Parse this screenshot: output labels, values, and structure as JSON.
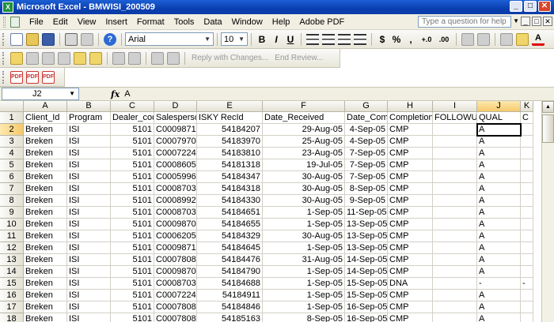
{
  "window": {
    "title": "Microsoft Excel - BMWISI_200509",
    "app_icon": "X",
    "buttons": [
      "_",
      "□",
      "✕"
    ]
  },
  "menubar": {
    "items": [
      "File",
      "Edit",
      "View",
      "Insert",
      "Format",
      "Tools",
      "Data",
      "Window",
      "Help",
      "Adobe PDF"
    ],
    "help_placeholder": "Type a question for help",
    "doc_buttons": [
      "_",
      "□",
      "✕"
    ]
  },
  "toolbar": {
    "font_name": "Arial",
    "font_size": "10",
    "bold": "B",
    "italic": "I",
    "underline": "U",
    "currency": "$",
    "percent": "%",
    "comma": ",",
    "inc_decimal": "+.0",
    "dec_decimal": ".00",
    "reply_changes": "Reply with Changes...",
    "end_review": "End Review..."
  },
  "formula_bar": {
    "name_box": "J2",
    "fx": "fx",
    "value": "A"
  },
  "grid": {
    "columns": [
      "A",
      "B",
      "C",
      "D",
      "E",
      "F",
      "G",
      "H",
      "I",
      "J",
      "K"
    ],
    "selected_column": "J",
    "selected_row": "2",
    "rows": [
      {
        "n": "1",
        "cells": [
          "Client_Id",
          "Program",
          "Dealer_code",
          "Salesperson",
          "ISKY RecId",
          "Date_Received",
          "Date_Completed",
          "Completion",
          "FOLLOWUP",
          "QUAL",
          "C"
        ]
      },
      {
        "n": "2",
        "cells": [
          "Breken",
          "ISI",
          "5101",
          "C0009871",
          "54184207",
          "29-Aug-05",
          "4-Sep-05",
          "CMP",
          "",
          "A",
          ""
        ]
      },
      {
        "n": "3",
        "cells": [
          "Breken",
          "ISI",
          "5101",
          "C0007970",
          "54183970",
          "25-Aug-05",
          "4-Sep-05",
          "CMP",
          "",
          "A",
          ""
        ]
      },
      {
        "n": "4",
        "cells": [
          "Breken",
          "ISI",
          "5101",
          "C0007224",
          "54183810",
          "23-Aug-05",
          "7-Sep-05",
          "CMP",
          "",
          "A",
          ""
        ]
      },
      {
        "n": "5",
        "cells": [
          "Breken",
          "ISI",
          "5101",
          "C0008605",
          "54181318",
          "19-Jul-05",
          "7-Sep-05",
          "CMP",
          "",
          "A",
          ""
        ]
      },
      {
        "n": "6",
        "cells": [
          "Breken",
          "ISI",
          "5101",
          "C0005996",
          "54184347",
          "30-Aug-05",
          "7-Sep-05",
          "CMP",
          "",
          "A",
          ""
        ]
      },
      {
        "n": "7",
        "cells": [
          "Breken",
          "ISI",
          "5101",
          "C0008703",
          "54184318",
          "30-Aug-05",
          "8-Sep-05",
          "CMP",
          "",
          "A",
          ""
        ]
      },
      {
        "n": "8",
        "cells": [
          "Breken",
          "ISI",
          "5101",
          "C0008992",
          "54184330",
          "30-Aug-05",
          "9-Sep-05",
          "CMP",
          "",
          "A",
          ""
        ]
      },
      {
        "n": "9",
        "cells": [
          "Breken",
          "ISI",
          "5101",
          "C0008703",
          "54184651",
          "1-Sep-05",
          "11-Sep-05",
          "CMP",
          "",
          "A",
          ""
        ]
      },
      {
        "n": "10",
        "cells": [
          "Breken",
          "ISI",
          "5101",
          "C0009870",
          "54184655",
          "1-Sep-05",
          "13-Sep-05",
          "CMP",
          "",
          "A",
          ""
        ]
      },
      {
        "n": "11",
        "cells": [
          "Breken",
          "ISI",
          "5101",
          "C0006205",
          "54184329",
          "30-Aug-05",
          "13-Sep-05",
          "CMP",
          "",
          "A",
          ""
        ]
      },
      {
        "n": "12",
        "cells": [
          "Breken",
          "ISI",
          "5101",
          "C0009871",
          "54184645",
          "1-Sep-05",
          "13-Sep-05",
          "CMP",
          "",
          "A",
          ""
        ]
      },
      {
        "n": "13",
        "cells": [
          "Breken",
          "ISI",
          "5101",
          "C0007808",
          "54184476",
          "31-Aug-05",
          "14-Sep-05",
          "CMP",
          "",
          "A",
          ""
        ]
      },
      {
        "n": "14",
        "cells": [
          "Breken",
          "ISI",
          "5101",
          "C0009870",
          "54184790",
          "1-Sep-05",
          "14-Sep-05",
          "CMP",
          "",
          "A",
          ""
        ]
      },
      {
        "n": "15",
        "cells": [
          "Breken",
          "ISI",
          "5101",
          "C0008703",
          "54184688",
          "1-Sep-05",
          "15-Sep-05",
          "DNA",
          "",
          "-",
          "-"
        ]
      },
      {
        "n": "16",
        "cells": [
          "Breken",
          "ISI",
          "5101",
          "C0007224",
          "54184911",
          "1-Sep-05",
          "15-Sep-05",
          "CMP",
          "",
          "A",
          ""
        ]
      },
      {
        "n": "17",
        "cells": [
          "Breken",
          "ISI",
          "5101",
          "C0007808",
          "54184846",
          "1-Sep-05",
          "16-Sep-05",
          "CMP",
          "",
          "A",
          ""
        ]
      },
      {
        "n": "18",
        "cells": [
          "Breken",
          "ISI",
          "5101",
          "C0007808",
          "54185163",
          "8-Sep-05",
          "16-Sep-05",
          "CMP",
          "",
          "A",
          ""
        ]
      }
    ]
  }
}
